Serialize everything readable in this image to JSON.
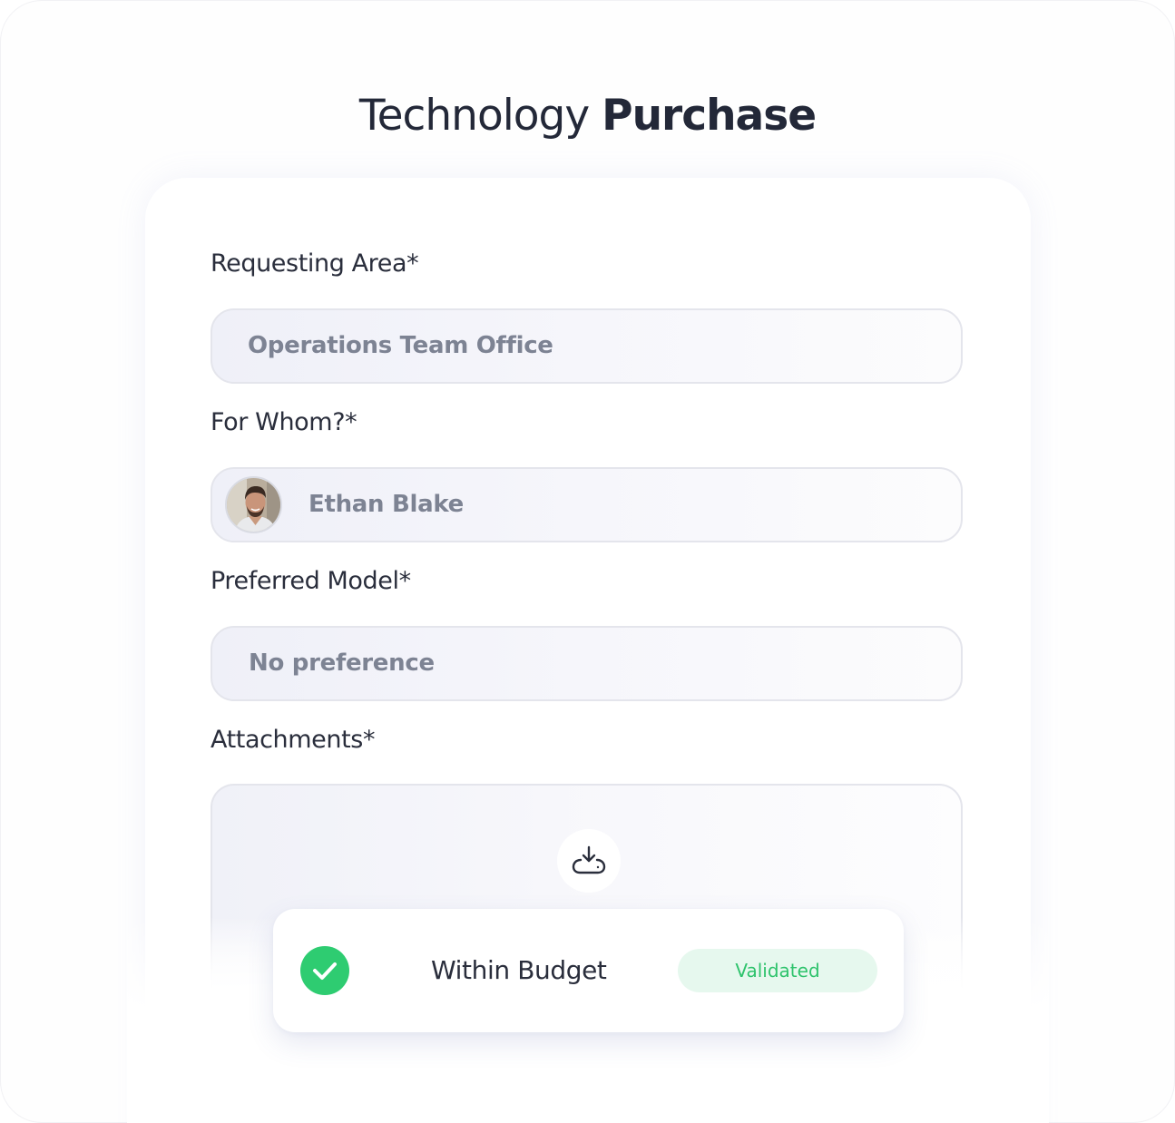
{
  "title": {
    "light": "Technology",
    "bold": "Purchase"
  },
  "form": {
    "requesting_area": {
      "label": "Requesting Area*",
      "value": "Operations Team Office"
    },
    "for_whom": {
      "label": "For Whom?*",
      "value": "Ethan Blake"
    },
    "preferred_model": {
      "label": "Preferred Model*",
      "value": "No preference"
    },
    "attachments": {
      "label": "Attachments*",
      "upload_icon": "cloud-download-icon"
    }
  },
  "status": {
    "icon": "check-circle-icon",
    "label": "Within Budget",
    "badge": "Validated",
    "colors": {
      "success": "#2ecc71",
      "badge_bg": "#e6f8ee",
      "badge_text": "#2ec36c"
    }
  }
}
